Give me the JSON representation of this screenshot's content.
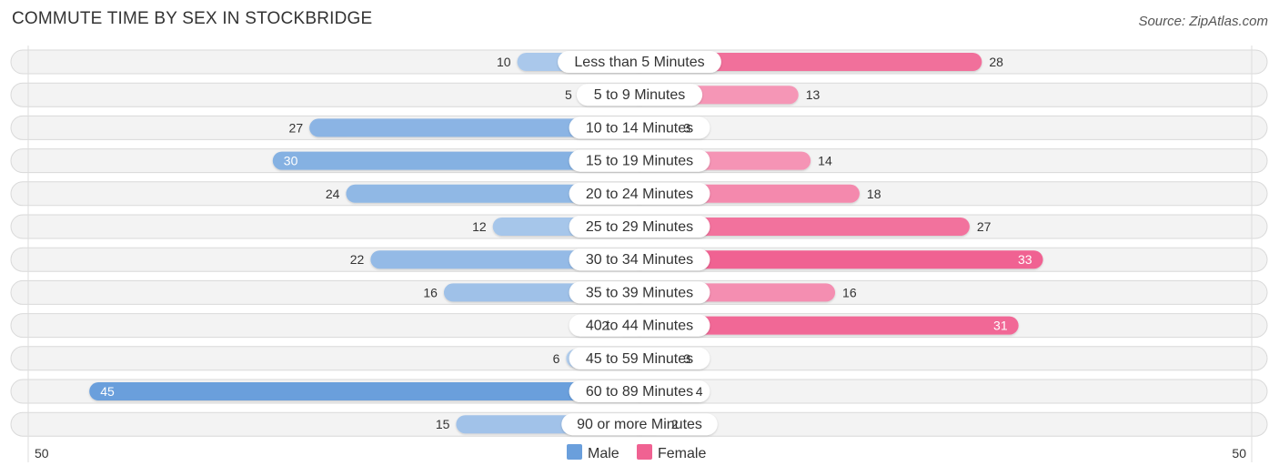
{
  "header": {
    "title": "COMMUTE TIME BY SEX IN STOCKBRIDGE",
    "source": "Source: ZipAtlas.com"
  },
  "chart_data": {
    "type": "bar",
    "orientation": "diverging-horizontal",
    "title": "COMMUTE TIME BY SEX IN STOCKBRIDGE",
    "categories": [
      "Less than 5 Minutes",
      "5 to 9 Minutes",
      "10 to 14 Minutes",
      "15 to 19 Minutes",
      "20 to 24 Minutes",
      "25 to 29 Minutes",
      "30 to 34 Minutes",
      "35 to 39 Minutes",
      "40 to 44 Minutes",
      "45 to 59 Minutes",
      "60 to 89 Minutes",
      "90 or more Minutes"
    ],
    "series": [
      {
        "name": "Male",
        "color": "#6a9fdc",
        "values": [
          10,
          5,
          27,
          30,
          24,
          12,
          22,
          16,
          2,
          6,
          45,
          15
        ]
      },
      {
        "name": "Female",
        "color": "#f06292",
        "values": [
          28,
          13,
          3,
          14,
          18,
          27,
          33,
          16,
          31,
          3,
          4,
          2
        ]
      }
    ],
    "axis": {
      "left_label": "50",
      "right_label": "50",
      "max": 50
    },
    "legend": {
      "position": "bottom-center",
      "entries": [
        "Male",
        "Female"
      ]
    },
    "xlabel": "",
    "ylabel": ""
  }
}
